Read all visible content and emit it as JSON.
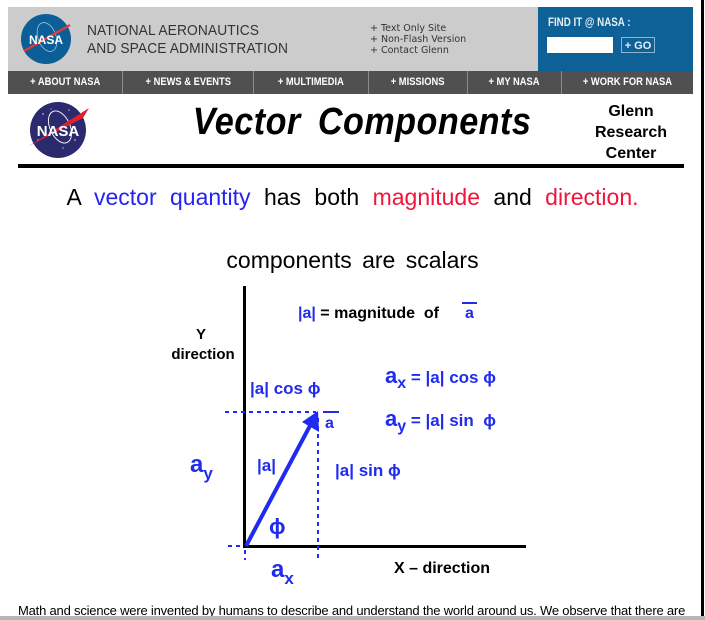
{
  "header": {
    "agency_line1": "NATIONAL AERONAUTICS",
    "agency_line2": "AND SPACE ADMINISTRATION",
    "logo_text": "NASA",
    "util_links": [
      "+ Text Only Site",
      "+ Non-Flash Version",
      "+ Contact Glenn"
    ],
    "search": {
      "label": "FIND IT @ NASA :",
      "input_value": "",
      "go_label": "+ GO"
    }
  },
  "nav": {
    "items": [
      {
        "label": "+ ABOUT NASA"
      },
      {
        "label": "+ NEWS & EVENTS"
      },
      {
        "label": "+ MULTIMEDIA"
      },
      {
        "label": "+ MISSIONS"
      },
      {
        "label": "+ MY NASA"
      },
      {
        "label": "+ WORK FOR NASA"
      }
    ]
  },
  "title_row": {
    "title": "Vector Components",
    "center_line1": "Glenn",
    "center_line2": "Research",
    "center_line3": "Center"
  },
  "statement": {
    "part1": "A",
    "part2": "vector quantity",
    "part3": "has both",
    "part4": "magnitude",
    "part5": "and",
    "part6": "direction."
  },
  "subtitle": "components are scalars",
  "diagram": {
    "colors": {
      "vector": "#1f2bf0",
      "axes": "#000000",
      "label_red": "#f0143a"
    },
    "y_label_line1": "Y",
    "y_label_line2": "direction",
    "x_label": "X – direction",
    "magnitude_def_prefix": "|a|",
    "magnitude_def_text": " = magnitude  of",
    "magnitude_def_vector": "a",
    "cos_label": "|a| cos ϕ",
    "sin_label": "|a| sin ϕ",
    "mag_label": "|a|",
    "vector_label": "a",
    "phi": "ϕ",
    "ay_label": "a",
    "ay_sub": "y",
    "ax_label": "a",
    "ax_sub": "x",
    "eq_x_lhs": "a",
    "eq_x_sub": "x",
    "eq_x_rhs": " = |a| cos ϕ",
    "eq_y_lhs": "a",
    "eq_y_sub": "y",
    "eq_y_rhs": " = |a| sin  ϕ"
  },
  "body_text": "Math and science were invented by humans to describe and understand the world around us. We observe that there are"
}
